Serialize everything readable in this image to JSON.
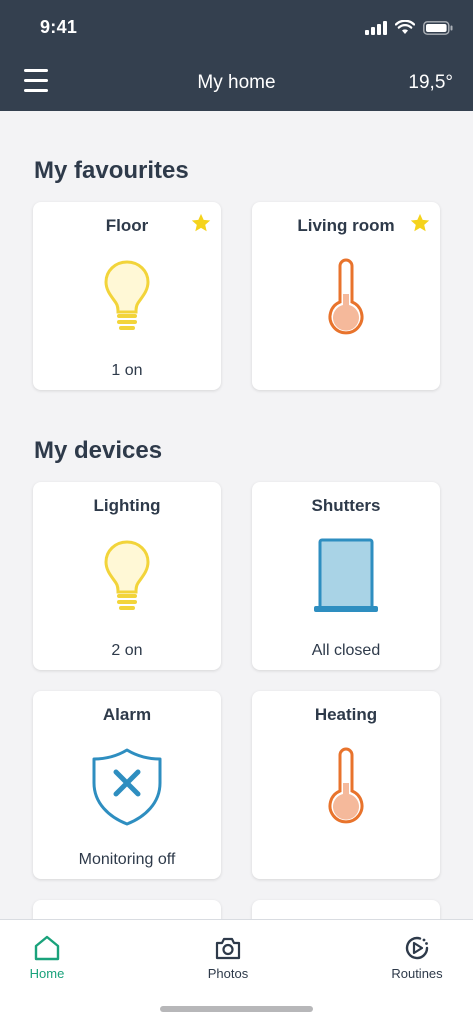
{
  "status_bar": {
    "time": "9:41"
  },
  "header": {
    "title": "My home",
    "temperature": "19,5°"
  },
  "favourites": {
    "title": "My favourites",
    "cards": [
      {
        "title": "Floor",
        "status": "1 on",
        "icon": "lightbulb-icon",
        "favourite": true
      },
      {
        "title": "Living room",
        "status": "",
        "icon": "thermometer-icon",
        "favourite": true
      }
    ]
  },
  "devices": {
    "title": "My devices",
    "cards": [
      {
        "title": "Lighting",
        "status": "2 on",
        "icon": "lightbulb-icon"
      },
      {
        "title": "Shutters",
        "status": "All closed",
        "icon": "shutter-icon"
      },
      {
        "title": "Alarm",
        "status": "Monitoring off",
        "icon": "shield-x-icon"
      },
      {
        "title": "Heating",
        "status": "",
        "icon": "thermometer-icon"
      }
    ]
  },
  "bottom_nav": [
    {
      "label": "Home",
      "icon": "home-icon",
      "active": true
    },
    {
      "label": "Photos",
      "icon": "camera-icon",
      "active": false
    },
    {
      "label": "Routines",
      "icon": "routines-icon",
      "active": false
    }
  ],
  "colors": {
    "header_bg": "#34404f",
    "accent": "#1aa27b",
    "bulb": "#f2d43a",
    "thermometer": "#e8732c",
    "shutter": "#2e8ec0",
    "alarm": "#2e8ec0",
    "star": "#f5d31c"
  }
}
